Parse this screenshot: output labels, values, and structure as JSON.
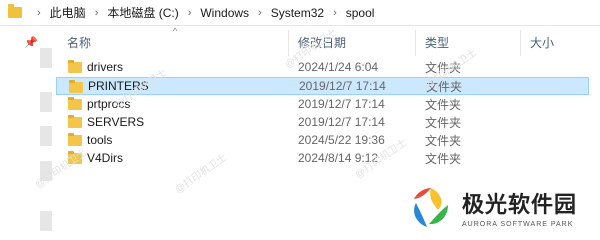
{
  "address": {
    "crumbs": [
      "此电脑",
      "本地磁盘 (C:)",
      "Windows",
      "System32",
      "spool"
    ]
  },
  "columns": {
    "name": "名称",
    "date": "修改日期",
    "type": "类型",
    "size": "大小"
  },
  "files": [
    {
      "name": "drivers",
      "date": "2024/1/24 6:04",
      "type": "文件夹",
      "selected": false
    },
    {
      "name": "PRINTERS",
      "date": "2019/12/7 17:14",
      "type": "文件夹",
      "selected": true
    },
    {
      "name": "prtprocs",
      "date": "2019/12/7 17:14",
      "type": "文件夹",
      "selected": false
    },
    {
      "name": "SERVERS",
      "date": "2019/12/7 17:14",
      "type": "文件夹",
      "selected": false
    },
    {
      "name": "tools",
      "date": "2024/5/22 19:36",
      "type": "文件夹",
      "selected": false
    },
    {
      "name": "V4Dirs",
      "date": "2024/8/14 9:12",
      "type": "文件夹",
      "selected": false
    }
  ],
  "watermark": "@打印机卫士",
  "logo": {
    "title": "极光软件园",
    "subtitle": "AURORA SOFTWARE PARK"
  },
  "colors": {
    "selected_bg": "#cce8ff",
    "folder": "#f3c64b",
    "header_text": "#4c607a"
  }
}
